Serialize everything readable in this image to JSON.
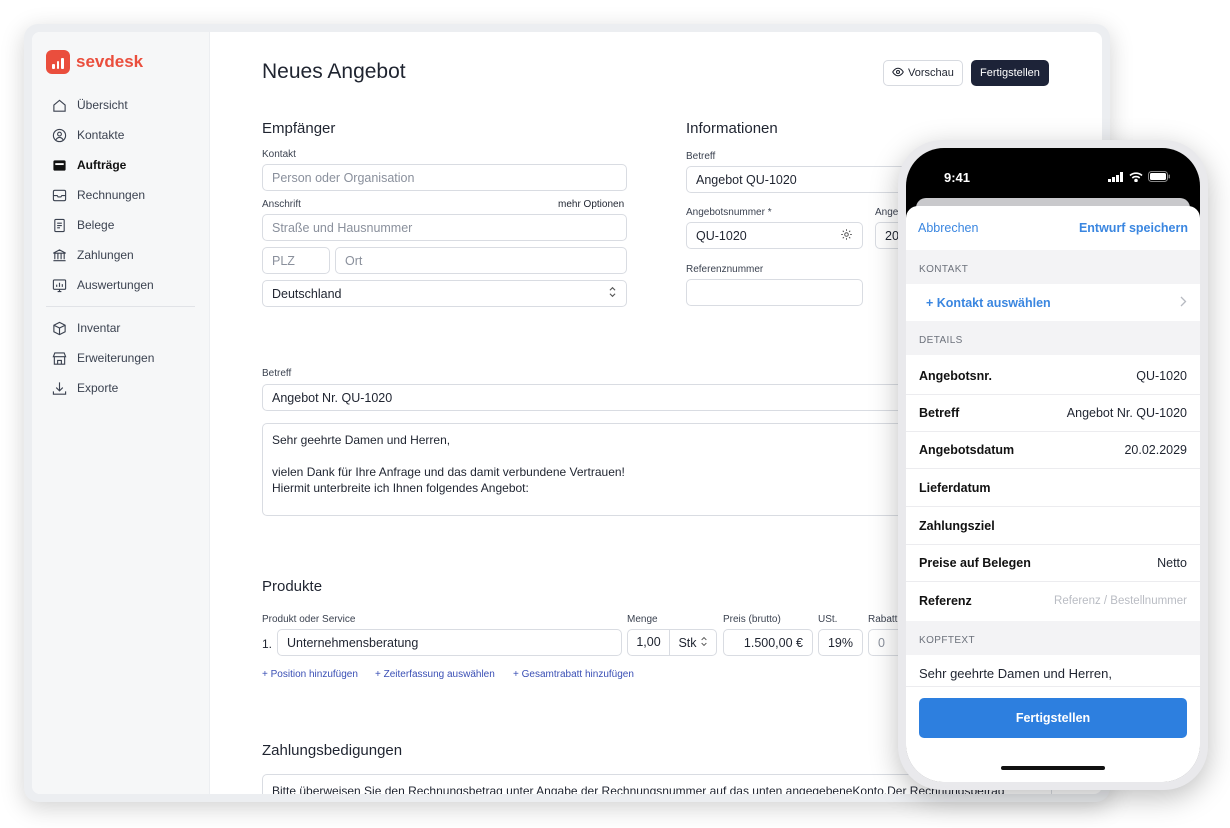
{
  "app": {
    "brand": "sevdesk",
    "brand_color": "#ea4e3d"
  },
  "sidebar": {
    "items": [
      {
        "label": "Übersicht",
        "icon": "home-icon"
      },
      {
        "label": "Kontakte",
        "icon": "contacts-icon"
      },
      {
        "label": "Aufträge",
        "icon": "orders-icon",
        "active": true
      },
      {
        "label": "Rechnungen",
        "icon": "invoice-icon"
      },
      {
        "label": "Belege",
        "icon": "receipt-icon"
      },
      {
        "label": "Zahlungen",
        "icon": "bank-icon"
      },
      {
        "label": "Auswertungen",
        "icon": "chart-icon"
      },
      {
        "label": "Inventar",
        "icon": "box-icon"
      },
      {
        "label": "Erweiterungen",
        "icon": "store-icon"
      },
      {
        "label": "Exporte",
        "icon": "download-icon"
      }
    ]
  },
  "header": {
    "title": "Neues Angebot",
    "preview_label": "Vorschau",
    "finish_label": "Fertigstellen"
  },
  "recipient": {
    "title": "Empfänger",
    "contact_label": "Kontakt",
    "contact_placeholder": "Person oder Organisation",
    "address_label": "Anschrift",
    "more_options": "mehr Optionen",
    "street_placeholder": "Straße und Hausnummer",
    "zip_placeholder": "PLZ",
    "city_placeholder": "Ort",
    "country": "Deutschland"
  },
  "info": {
    "title": "Informationen",
    "subject_label": "Betreff",
    "subject_value": "Angebot QU-1020",
    "number_label": "Angebotsnummer *",
    "number_value": "QU-1020",
    "date_label": "Ange",
    "date_value": "20",
    "ref_label": "Referenznummer"
  },
  "subject": {
    "label": "Betreff",
    "value": "Angebot Nr. QU-1020",
    "body": [
      "Sehr geehrte Damen und Herren,",
      "",
      "vielen Dank für Ihre Anfrage und das damit verbundene Vertrauen!",
      "Hiermit unterbreite ich Ihnen folgendes Angebot:"
    ]
  },
  "products": {
    "title": "Produkte",
    "col_product": "Produkt oder Service",
    "col_qty": "Menge",
    "col_price": "Preis (brutto)",
    "col_vat": "USt.",
    "col_discount": "Rabatt",
    "row_index": "1.",
    "row_name": "Unternehmensberatung",
    "row_qty": "1,00",
    "row_unit": "Stk",
    "row_price": "1.500,00 €",
    "row_vat": "19%",
    "row_discount": "0",
    "add_position": "+ Position hinzufügen",
    "add_time": "+ Zeiterfassung auswählen",
    "add_discount": "+ Gesamtrabatt hinzufügen"
  },
  "payment": {
    "title": "Zahlungsbedigungen",
    "text": "Bitte überweisen Sie den Rechnungsbetrag unter Angabe der Rechnungsnummer auf das unten angegebeneKonto.Der Rechnungsbetrag"
  },
  "phone": {
    "time": "9:41",
    "cancel": "Abbrechen",
    "save": "Entwurf speichern",
    "section_contact": "KONTAKT",
    "select_contact": "+ Kontakt auswählen",
    "section_details": "DETAILS",
    "rows": [
      {
        "k": "Angebotsnr.",
        "v": "QU-1020"
      },
      {
        "k": "Betreff",
        "v": "Angebot Nr. QU-1020"
      },
      {
        "k": "Angebotsdatum",
        "v": "20.02.2029"
      },
      {
        "k": "Lieferdatum",
        "v": ""
      },
      {
        "k": "Zahlungsziel",
        "v": ""
      },
      {
        "k": "Preise auf Belegen",
        "v": "Netto"
      },
      {
        "k": "Referenz",
        "v": "",
        "placeholder": "Referenz / Bestellnummer"
      }
    ],
    "section_header_text": "KOPFTEXT",
    "header_text": "Sehr geehrte Damen und Herren,",
    "cta": "Fertigstellen",
    "accent": "#2d7fdf"
  }
}
